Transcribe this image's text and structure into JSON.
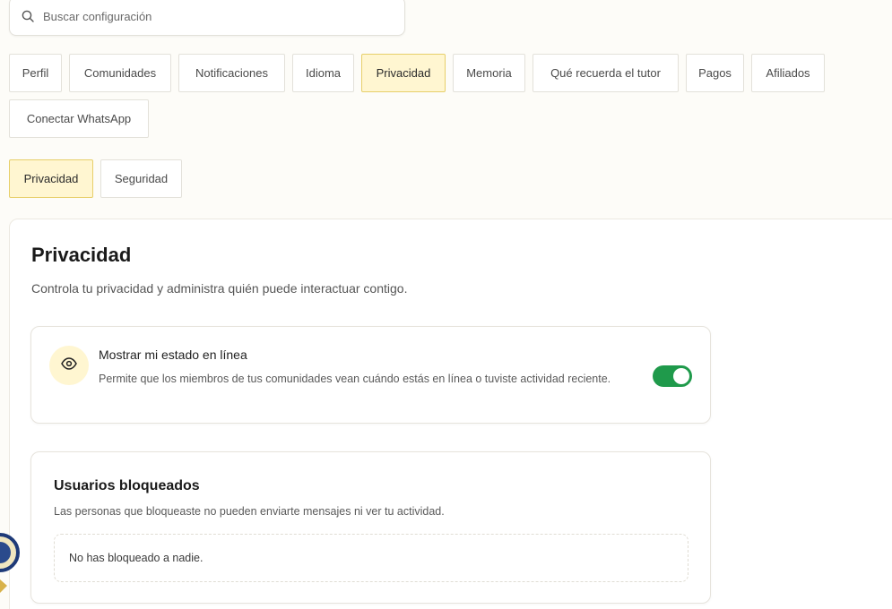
{
  "search": {
    "placeholder": "Buscar configuración",
    "icon": "search-icon"
  },
  "main_tabs": [
    {
      "label": "Perfil",
      "active": false
    },
    {
      "label": "Comunidades",
      "active": false
    },
    {
      "label": "Notificaciones",
      "active": false
    },
    {
      "label": "Idioma",
      "active": false
    },
    {
      "label": "Privacidad",
      "active": true
    },
    {
      "label": "Memoria",
      "active": false
    },
    {
      "label": "Qué recuerda el tutor",
      "active": false
    },
    {
      "label": "Pagos",
      "active": false
    },
    {
      "label": "Afiliados",
      "active": false
    },
    {
      "label": "Conectar WhatsApp",
      "active": false
    }
  ],
  "sub_tabs": [
    {
      "label": "Privacidad",
      "active": true
    },
    {
      "label": "Seguridad",
      "active": false
    }
  ],
  "section": {
    "title": "Privacidad",
    "subtitle": "Controla tu privacidad y administra quién puede interactuar contigo."
  },
  "online_status": {
    "icon": "eye-icon",
    "title": "Mostrar mi estado en línea",
    "description": "Permite que los miembros de tus comunidades vean cuándo estás en línea o tuviste actividad reciente.",
    "enabled": true
  },
  "blocked_users": {
    "title": "Usuarios bloqueados",
    "description": "Las personas que bloqueaste no pueden enviarte mensajes ni ver tu actividad.",
    "empty_text": "No has bloqueado a nadie."
  },
  "colors": {
    "accent_bg": "#fff6d1",
    "accent_border": "#e7cf6a",
    "toggle_on": "#1f9a4b",
    "page_bg": "#fdfcf8"
  }
}
